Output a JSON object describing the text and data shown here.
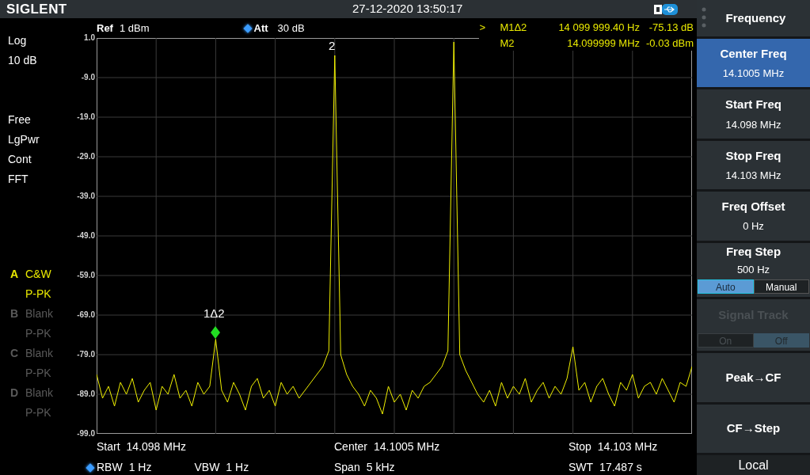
{
  "header": {
    "logo": "SIGLENT",
    "datetime": "27-12-2020 13:50:17"
  },
  "ref": {
    "label": "Ref",
    "value": "1 dBm"
  },
  "att": {
    "label": "Att",
    "value": "30 dB"
  },
  "marker_readouts": [
    {
      "pointer": ">",
      "name": "M1Δ2",
      "frequency": "14 099 999.40 Hz",
      "amplitude": "-75.13 dB"
    },
    {
      "name": "M2",
      "frequency": "14.099999 MHz",
      "amplitude": "-0.03 dBm"
    }
  ],
  "scale": [
    "Log",
    "10 dB"
  ],
  "sweep_info": [
    "Free",
    "LgPwr",
    "Cont",
    "FFT"
  ],
  "traces": [
    {
      "letter": "A",
      "mode": "C&W",
      "detector": "P-PK",
      "active": true
    },
    {
      "letter": "B",
      "mode": "Blank",
      "detector": "P-PK",
      "active": false
    },
    {
      "letter": "C",
      "mode": "Blank",
      "detector": "P-PK",
      "active": false
    },
    {
      "letter": "D",
      "mode": "Blank",
      "detector": "P-PK",
      "active": false
    }
  ],
  "plot": {
    "markers": [
      {
        "label": "2"
      },
      {
        "label": "1Δ2"
      }
    ],
    "chart_data": {
      "type": "line",
      "grid": true,
      "ylim": [
        -99,
        1
      ],
      "yticks": [
        {
          "value": 1,
          "label": "1.0"
        },
        {
          "value": -9,
          "label": "-9.0"
        },
        {
          "value": -19,
          "label": "-19.0"
        },
        {
          "value": -29,
          "label": "-29.0"
        },
        {
          "value": -39,
          "label": "-39.0"
        },
        {
          "value": -49,
          "label": "-49.0"
        },
        {
          "value": -59,
          "label": "-59.0"
        },
        {
          "value": -69,
          "label": "-69.0"
        },
        {
          "value": -79,
          "label": "-79.0"
        },
        {
          "value": -89,
          "label": "-89.0"
        },
        {
          "value": -99,
          "label": "-99.0"
        }
      ],
      "series": [
        {
          "color": "#f0f000",
          "values": [
            -84,
            -90,
            -87,
            -92,
            -86,
            -89,
            -85,
            -91,
            -88,
            -86,
            -93,
            -87,
            -89,
            -84,
            -90,
            -88,
            -92,
            -86,
            -89,
            -87,
            -75.1,
            -88,
            -91,
            -86,
            -89,
            -93,
            -87,
            -85,
            -90,
            -88,
            -92,
            -86,
            -89,
            -87,
            -90,
            -88,
            -86,
            -84,
            -82,
            -78,
            -3.4,
            -79,
            -84,
            -87,
            -89,
            -92,
            -88,
            -90,
            -94,
            -87,
            -91,
            -89,
            -93,
            -88,
            -90,
            -87,
            -86,
            -84,
            -82,
            -78,
            0,
            -79,
            -83,
            -86,
            -89,
            -91,
            -88,
            -92,
            -86,
            -90,
            -87,
            -89,
            -85,
            -91,
            -88,
            -86,
            -90,
            -87,
            -89,
            -85,
            -77,
            -88,
            -86,
            -91,
            -87,
            -85,
            -89,
            -92,
            -86,
            -88,
            -84,
            -90,
            -87,
            -86,
            -89,
            -85,
            -88,
            -91,
            -86,
            -87,
            -82
          ]
        }
      ]
    }
  },
  "bottom_rows": [
    [
      {
        "label": "Start",
        "value": "14.098 MHz"
      },
      {
        "label": "Center",
        "value": "14.1005 MHz"
      },
      {
        "label": "Stop",
        "value": "14.103 MHz"
      }
    ],
    [
      {
        "label": "RBW",
        "value": "1 Hz",
        "second_label": "VBW",
        "second_value": "1 Hz"
      },
      {
        "label": "Span",
        "value": "5 kHz"
      },
      {
        "label": "SWT",
        "value": "17.487 s"
      }
    ]
  ],
  "menu": {
    "title": "Frequency",
    "items": [
      {
        "kind": "value",
        "label": "Center Freq",
        "value": "14.1005 MHz",
        "selected": true
      },
      {
        "kind": "value",
        "label": "Start Freq",
        "value": "14.098 MHz",
        "selected": false
      },
      {
        "kind": "value",
        "label": "Stop Freq",
        "value": "14.103 MHz",
        "selected": false
      },
      {
        "kind": "value",
        "label": "Freq Offset",
        "value": "0 Hz",
        "selected": false
      },
      {
        "kind": "toggle",
        "label": "Freq Step",
        "value": "500 Hz",
        "disabled": false,
        "options": [
          {
            "label": "Auto",
            "selected": true
          },
          {
            "label": "Manual",
            "selected": false
          }
        ]
      },
      {
        "kind": "toggle",
        "label": "Signal Track",
        "disabled": true,
        "options": [
          {
            "label": "On",
            "selected": false
          },
          {
            "label": "Off",
            "selected": true
          }
        ]
      },
      {
        "kind": "action",
        "label": "Peak→CF"
      },
      {
        "kind": "action",
        "label": "CF→Step"
      }
    ],
    "footer": "Local"
  }
}
